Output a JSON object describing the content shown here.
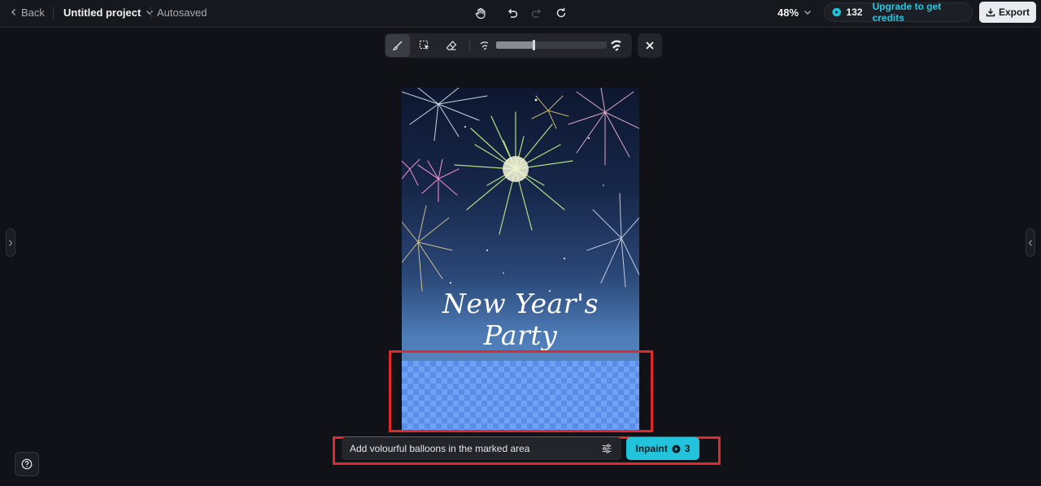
{
  "header": {
    "back_label": "Back",
    "project_name": "Untitled project",
    "save_status": "Autosaved",
    "zoom": "48%",
    "credits": "132",
    "upgrade_label": "Upgrade to get credits",
    "export_label": "Export"
  },
  "toolbar": {
    "tools": [
      "brush-icon",
      "lasso-select-icon",
      "eraser-icon"
    ],
    "brush_size_fraction": 0.34
  },
  "canvas": {
    "title_text": "New Year's Party"
  },
  "prompt": {
    "value": "Add volourful balloons in the marked area",
    "inpaint_label": "Inpaint",
    "inpaint_cost": "3"
  },
  "colors": {
    "accent": "#22c4dc",
    "annotation_red": "#e02a2a",
    "background": "#111217"
  }
}
